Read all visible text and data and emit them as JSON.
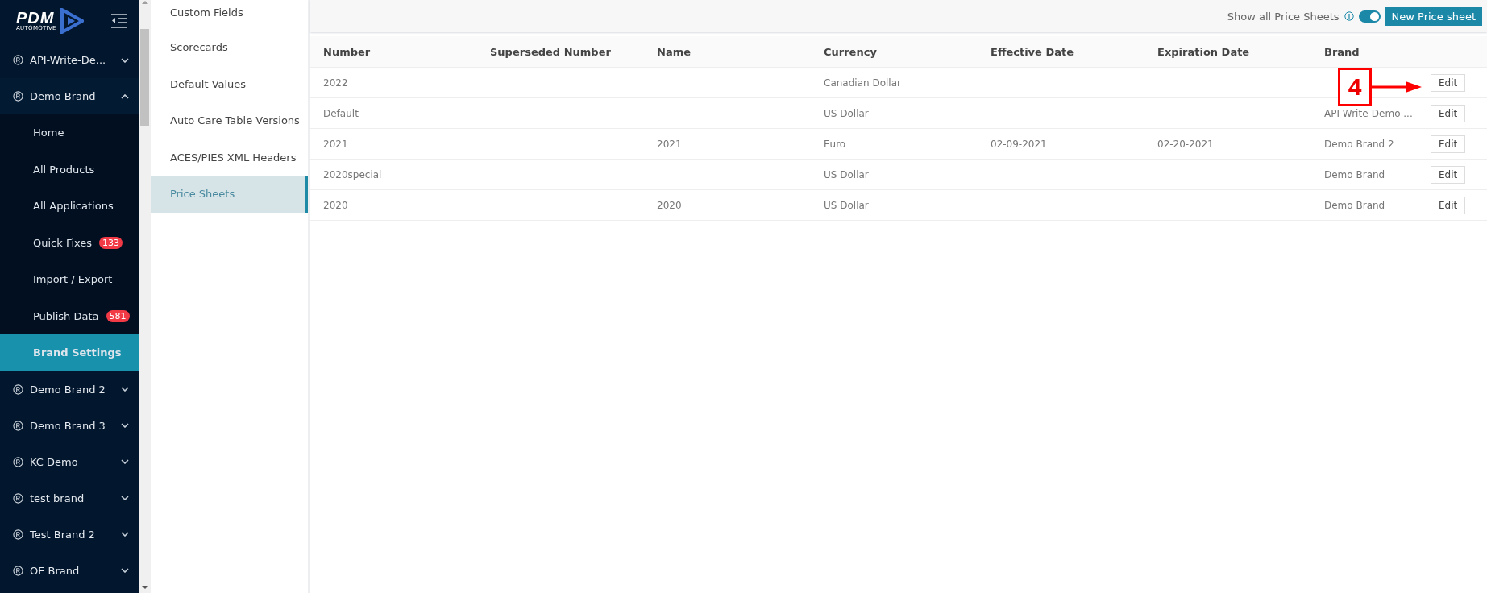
{
  "logo": {
    "name": "PDM",
    "tagline": "AUTOMOTIVE"
  },
  "sidebar": {
    "items": [
      {
        "label": "API-Write-De...",
        "expanded": false
      },
      {
        "label": "Demo Brand",
        "expanded": true,
        "children": [
          {
            "label": "Home",
            "selected": false
          },
          {
            "label": "All Products",
            "selected": false
          },
          {
            "label": "All Applications",
            "selected": false
          },
          {
            "label": "Quick Fixes",
            "selected": false,
            "badge": "133"
          },
          {
            "label": "Import / Export",
            "selected": false
          },
          {
            "label": "Publish Data",
            "selected": false,
            "badge": "581"
          },
          {
            "label": "Brand Settings",
            "selected": true
          }
        ]
      },
      {
        "label": "Demo Brand 2",
        "expanded": false
      },
      {
        "label": "Demo Brand 3",
        "expanded": false
      },
      {
        "label": "KC Demo",
        "expanded": false
      },
      {
        "label": "test brand",
        "expanded": false
      },
      {
        "label": "Test Brand 2",
        "expanded": false
      },
      {
        "label": "OE Brand",
        "expanded": false
      }
    ]
  },
  "settings_menu": {
    "items": [
      {
        "label": "Custom Fields",
        "selected": false
      },
      {
        "label": "Scorecards",
        "selected": false
      },
      {
        "label": "Default Values",
        "selected": false
      },
      {
        "label": "Auto Care Table Versions",
        "selected": false
      },
      {
        "label": "ACES/PIES XML Headers",
        "selected": false
      },
      {
        "label": "Price Sheets",
        "selected": true
      }
    ]
  },
  "toolbar": {
    "toggle_label": "Show all Price Sheets",
    "show_all": true,
    "new_button": "New Price sheet"
  },
  "table": {
    "columns": [
      "Number",
      "Superseded Number",
      "Name",
      "Currency",
      "Effective Date",
      "Expiration Date",
      "Brand"
    ],
    "rows": [
      {
        "cells": [
          "2022",
          "",
          "",
          "Canadian Dollar",
          "",
          "",
          ""
        ],
        "action": "Edit"
      },
      {
        "cells": [
          "Default",
          "",
          "",
          "US Dollar",
          "",
          "",
          "API-Write-Demo ..."
        ],
        "action": "Edit"
      },
      {
        "cells": [
          "2021",
          "",
          "2021",
          "Euro",
          "02-09-2021",
          "02-20-2021",
          "Demo Brand 2"
        ],
        "action": "Edit"
      },
      {
        "cells": [
          "2020special",
          "",
          "",
          "US Dollar",
          "",
          "",
          "Demo Brand"
        ],
        "action": "Edit"
      },
      {
        "cells": [
          "2020",
          "",
          "2020",
          "US Dollar",
          "",
          "",
          "Demo Brand"
        ],
        "action": "Edit"
      }
    ]
  },
  "callout": {
    "label": "4"
  }
}
